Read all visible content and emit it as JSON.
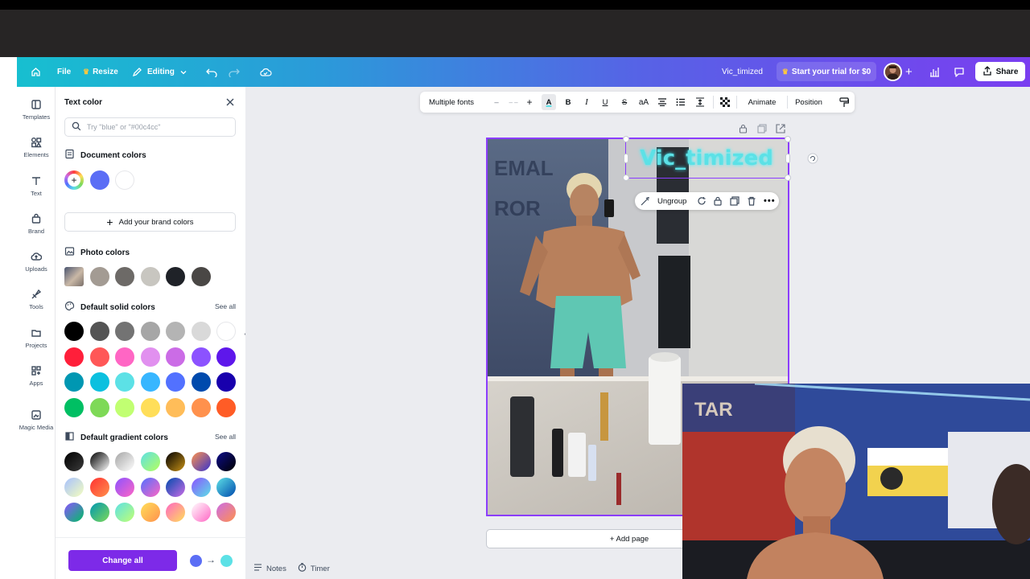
{
  "header": {
    "file": "File",
    "resize": "Resize",
    "editing": "Editing",
    "doc_title": "Vic_timized",
    "trial": "Start your trial for $0",
    "share": "Share",
    "gradient_start": "#17bfd0",
    "gradient_end": "#7a3ef0"
  },
  "rail": {
    "items": [
      {
        "label": "Templates",
        "icon": "templates-icon"
      },
      {
        "label": "Elements",
        "icon": "elements-icon"
      },
      {
        "label": "Text",
        "icon": "text-icon"
      },
      {
        "label": "Brand",
        "icon": "brand-icon"
      },
      {
        "label": "Uploads",
        "icon": "uploads-icon"
      },
      {
        "label": "Tools",
        "icon": "tools-icon"
      },
      {
        "label": "Projects",
        "icon": "projects-icon"
      },
      {
        "label": "Apps",
        "icon": "apps-icon"
      },
      {
        "label": "Magic Media",
        "icon": "magic-media-icon"
      }
    ]
  },
  "panel": {
    "title": "Text color",
    "search_placeholder": "Try \"blue\" or \"#00c4cc\"",
    "document_colors_title": "Document colors",
    "document_colors": [
      "#5b6ef5",
      "#ffffff"
    ],
    "add_brand": "Add your brand colors",
    "photo_colors_title": "Photo colors",
    "photo_colors": [
      "#a39b93",
      "#6d6a67",
      "#c8c6c0",
      "#1f2228",
      "#4a4745"
    ],
    "default_solid_title": "Default solid colors",
    "see_all": "See all",
    "solid_colors": [
      [
        "#000000",
        "#545454",
        "#737373",
        "#a6a6a6",
        "#b4b4b4",
        "#d9d9d9",
        "#ffffff"
      ],
      [
        "#ff1f3a",
        "#ff5757",
        "#ff66c4",
        "#e190ef",
        "#cb6ce6",
        "#8c52ff",
        "#5e17eb"
      ],
      [
        "#0097b2",
        "#0cc0df",
        "#5ce1e6",
        "#38b6ff",
        "#5271ff",
        "#004aad",
        "#1800ad"
      ],
      [
        "#00bf63",
        "#7ed957",
        "#c1ff72",
        "#ffde59",
        "#ffbd59",
        "#ff914d",
        "#ff5c26"
      ]
    ],
    "default_gradient_title": "Default gradient colors",
    "gradients": [
      [
        [
          "#000000",
          "#3b3b3b"
        ],
        [
          "#000000",
          "#ffffff"
        ],
        [
          "#a6a6a6",
          "#ffffff"
        ],
        [
          "#5de0e6",
          "#b5ff5c"
        ],
        [
          "#000000",
          "#c89116"
        ],
        [
          "#ff914d",
          "#3533cd"
        ],
        [
          "#0d0d8a",
          "#000000"
        ]
      ],
      [
        [
          "#a6c0fe",
          "#f6ffbe"
        ],
        [
          "#ff3131",
          "#ff914d"
        ],
        [
          "#8c52ff",
          "#ff66c4"
        ],
        [
          "#5170ff",
          "#ff66c4"
        ],
        [
          "#004aad",
          "#cb6ce6"
        ],
        [
          "#8c52ff",
          "#5ce1e6"
        ],
        [
          "#5de0e6",
          "#004aad"
        ]
      ],
      [
        [
          "#8c52ff",
          "#00bf63"
        ],
        [
          "#0097b2",
          "#7ed957"
        ],
        [
          "#5ce1e6",
          "#c1ff72"
        ],
        [
          "#ffde59",
          "#ff914d"
        ],
        [
          "#ff66c4",
          "#ffde59"
        ],
        [
          "#ffffff",
          "#ff66c4"
        ],
        [
          "#cb6ce6",
          "#ff914d"
        ]
      ]
    ],
    "change_all": "Change all",
    "change_from": "#5b6ef5",
    "change_to": "#5ce1e6"
  },
  "toolbar": {
    "font": "Multiple fonts",
    "size": "– –",
    "animate": "Animate",
    "position": "Position"
  },
  "canvas": {
    "overlay_text": "Vic_timized",
    "ungroup": "Ungroup",
    "add_page": "+ Add page",
    "notes": "Notes",
    "timer": "Timer",
    "selection_color": "#8b3dff"
  }
}
